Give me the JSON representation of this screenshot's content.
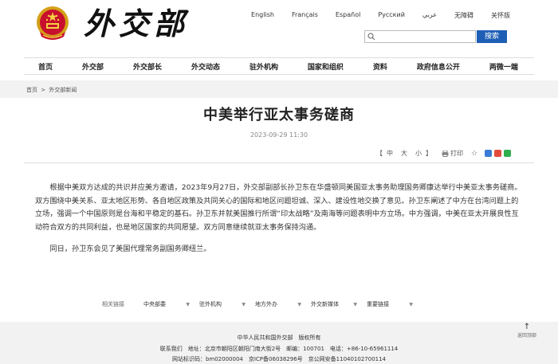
{
  "header": {
    "logo_text": "外交部",
    "languages": [
      "English",
      "Français",
      "Español",
      "Русский",
      "عربي",
      "无障碍",
      "关怀版"
    ],
    "search": {
      "placeholder": "",
      "button_label": "搜索"
    }
  },
  "nav": {
    "items": [
      "首页",
      "外交部",
      "外交部长",
      "外交动态",
      "驻外机构",
      "国家和组织",
      "资料",
      "政府信息公开",
      "两微一端"
    ]
  },
  "breadcrumb": {
    "home": "首页",
    "separator": ">",
    "current": "外交部新闻"
  },
  "article": {
    "title": "中美举行亚太事务磋商",
    "date": "2023-09-29 11:30",
    "font_size_controls": {
      "open": "【",
      "large": "中",
      "mid": "大",
      "small": "小",
      "close": "】"
    },
    "print_label": "打印",
    "share_colors": [
      "#3a7bd5",
      "#e24b3b",
      "#2fae4f"
    ],
    "paragraphs": [
      "根据中美双方达成的共识并应美方邀请，2023年9月27日，外交部副部长孙卫东在华盛顿同美国亚太事务助理国务卿康达举行中美亚太事务磋商。双方围绕中美关系、亚太地区形势、各自地区政策及共同关心的国际和地区问题坦诚、深入、建设性地交换了意见。孙卫东阐述了中方在台湾问题上的立场，强调一个中国原则是台海和平稳定的基石。孙卫东并就美国推行所谓“印太战略”及南海等问题表明中方立场。中方强调，中美在亚太开展良性互动符合双方的共同利益，也是地区国家的共同愿望。双方同意继续就亚太事务保持沟通。",
      "同日，孙卫东会见了美国代理常务副国务卿纽兰。"
    ]
  },
  "related": {
    "label": "相关链接",
    "items": [
      "中央部委",
      "驻外机构",
      "地方外办",
      "外交新媒体",
      "重要链接"
    ]
  },
  "footer": {
    "line1": "中华人民共和国外交部　版权所有",
    "line2": "联系我们　地址：北京市朝阳区朝阳门南大街2号　邮编：100701　电话：+86-10-65961114",
    "line3": "网站标识码：bm02000004　京ICP备06038296号　京公网安备11040102700114",
    "back_to_top": "返回顶部"
  }
}
